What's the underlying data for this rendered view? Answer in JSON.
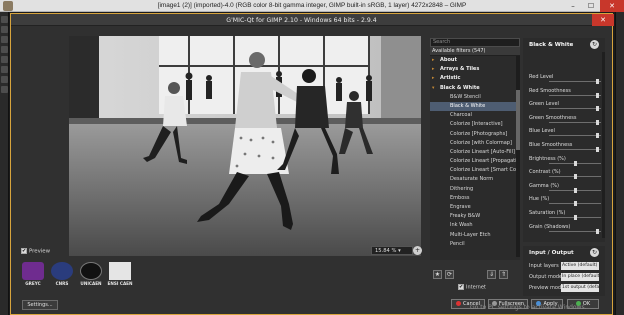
{
  "window": {
    "title": "[image1 (2)] (imported)-4.0 (RGB color 8-bit gamma integer, GIMP built-in sRGB, 1 layer) 4272x2848 – GIMP",
    "min_icon": "minimize-icon",
    "max_icon": "maximize-icon",
    "close_label": "✕"
  },
  "dialog": {
    "title": "G'MIC-Qt for GIMP 2.10 - Windows 64 bits - 2.9.4",
    "close_label": "✕"
  },
  "preview": {
    "zoom_value": "15.84 % ▾",
    "zoom_in": "+",
    "zoom_out": "−",
    "zoom_reset": "↻",
    "toggle_label": "Preview",
    "toggle_checked": true
  },
  "logos": [
    {
      "label": "GREYC",
      "color": "#6f2c8f"
    },
    {
      "label": "CNRS",
      "color": "#2a3c7d"
    },
    {
      "label": "UNICAEN",
      "color": "#111111"
    },
    {
      "label": "ENSI CAEN",
      "color": "#e5e5e5"
    }
  ],
  "settings_button": "Settings...",
  "filters": {
    "search_placeholder": "Search",
    "header": "Available filters (547)",
    "rows": [
      {
        "label": "About",
        "type": "cat",
        "arrow": "▸"
      },
      {
        "label": "Arrays & Tiles",
        "type": "cat",
        "arrow": "▸"
      },
      {
        "label": "Artistic",
        "type": "cat",
        "arrow": "▸"
      },
      {
        "label": "Black & White",
        "type": "cat",
        "arrow": "▾"
      },
      {
        "label": "B&W Stencil",
        "type": "leaf"
      },
      {
        "label": "Black & White",
        "type": "leaf",
        "selected": true
      },
      {
        "label": "Charcoal",
        "type": "leaf"
      },
      {
        "label": "Colorize [Interactive]",
        "type": "leaf"
      },
      {
        "label": "Colorize [Photographs]",
        "type": "leaf"
      },
      {
        "label": "Colorize [with Colormap]",
        "type": "leaf"
      },
      {
        "label": "Colorize Lineart [Auto-Fill]",
        "type": "leaf"
      },
      {
        "label": "Colorize Lineart [Propagation]",
        "type": "leaf"
      },
      {
        "label": "Colorize Lineart [Smart Coloring]",
        "type": "leaf"
      },
      {
        "label": "Desaturate Norm",
        "type": "leaf"
      },
      {
        "label": "Dithering",
        "type": "leaf"
      },
      {
        "label": "Emboss",
        "type": "leaf"
      },
      {
        "label": "Engrave",
        "type": "leaf"
      },
      {
        "label": "Freaky B&W",
        "type": "leaf"
      },
      {
        "label": "Ink Wash",
        "type": "leaf"
      },
      {
        "label": "Multi-Layer Etch",
        "type": "leaf"
      },
      {
        "label": "Pencil",
        "type": "leaf"
      }
    ],
    "tools": {
      "add_fav": "★",
      "refresh": "⟳",
      "expand": "⇓",
      "collapse": "⇑"
    },
    "internet_label": "Internet",
    "internet_checked": true
  },
  "params": {
    "title": "Black & White",
    "reset": "↻",
    "items": [
      {
        "label": "Red Level",
        "value": 0.93
      },
      {
        "label": "Red Smoothness",
        "value": 0.93
      },
      {
        "label": "Green Level",
        "value": 0.93
      },
      {
        "label": "Green Smoothness",
        "value": 0.93
      },
      {
        "label": "Blue Level",
        "value": 0.93
      },
      {
        "label": "Blue Smoothness",
        "value": 0.93
      },
      {
        "label": "Brightness (%)",
        "value": 0.5
      },
      {
        "label": "Contrast (%)",
        "value": 0.5
      },
      {
        "label": "Gamma (%)",
        "value": 0.5
      },
      {
        "label": "Hue (%)",
        "value": 0.5
      },
      {
        "label": "Saturation (%)",
        "value": 0.5
      },
      {
        "label": "Grain (Shadows)",
        "value": 0.93
      }
    ]
  },
  "io": {
    "title": "Input / Output",
    "reset": "↻",
    "rows": [
      {
        "label": "Input layers",
        "value": "Active (default)"
      },
      {
        "label": "Output mode",
        "value": "In place (default)"
      },
      {
        "label": "Preview mode",
        "value": "1st output (default)"
      }
    ]
  },
  "buttons": {
    "cancel": "Cancel",
    "fullscreen": "Fullscreen",
    "apply": "Apply",
    "ok": "OK"
  },
  "watermark": "Go to PC settings to activate Windows.",
  "colors": {
    "accent_border": "#d7a43d",
    "selection": "#4e5d72",
    "close_red": "#c8372b"
  }
}
